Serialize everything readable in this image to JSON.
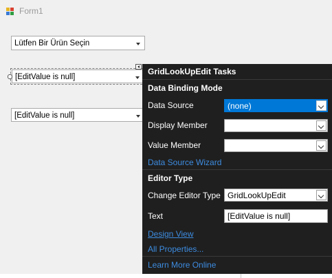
{
  "window": {
    "title": "Form1"
  },
  "form": {
    "combo1_value": "Lütfen Bir Ürün Seçin",
    "combo2_value": "[EditValue is null]",
    "combo3_value": "[EditValue is null]"
  },
  "tasks_panel": {
    "title": "GridLookUpEdit Tasks",
    "data_binding_section": "Data Binding Mode",
    "data_source_label": "Data Source",
    "data_source_value": "(none)",
    "display_member_label": "Display Member",
    "display_member_value": "",
    "value_member_label": "Value Member",
    "value_member_value": "",
    "data_source_wizard_link": "Data Source Wizard",
    "editor_type_section": "Editor Type",
    "change_editor_type_label": "Change Editor Type",
    "change_editor_type_value": "GridLookUpEdit",
    "text_label": "Text",
    "text_value": "[EditValue is null]",
    "design_view_link": "Design View",
    "all_properties_link": "All Properties...",
    "learn_more_link": "Learn More Online"
  },
  "colors": {
    "panel_background": "#1f1f1f",
    "link": "#3d8ce0",
    "selection": "#0078d7",
    "form_background": "#f0f0f0"
  }
}
